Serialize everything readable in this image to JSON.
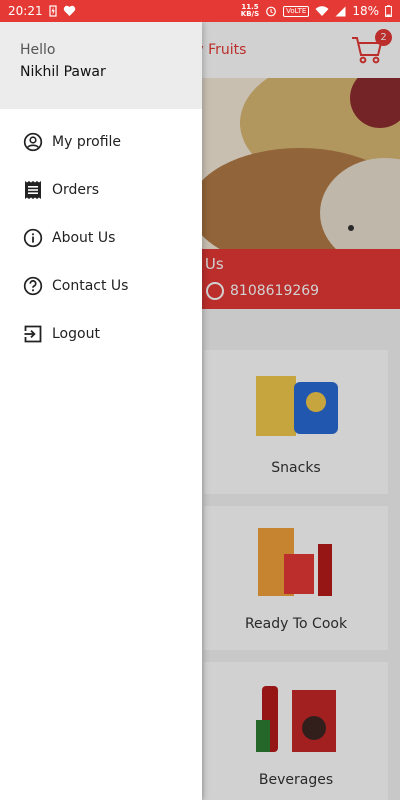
{
  "status_bar": {
    "time": "20:21",
    "netspeed_value": "11.5",
    "netspeed_unit": "KB/S",
    "volte": "VoLTE",
    "battery": "18%"
  },
  "app": {
    "title": "tu Dry Fruits",
    "cart_count": "2",
    "contact_title": "ct Us",
    "contact_phone": "8108619269",
    "categories": [
      {
        "label": "Snacks"
      },
      {
        "label": "Ready To Cook"
      },
      {
        "label": "Beverages"
      }
    ]
  },
  "drawer": {
    "greeting": "Hello",
    "user_name": "Nikhil Pawar",
    "items": [
      {
        "label": "My profile",
        "icon": "profile-icon"
      },
      {
        "label": "Orders",
        "icon": "orders-icon"
      },
      {
        "label": "About Us",
        "icon": "info-icon"
      },
      {
        "label": "Contact Us",
        "icon": "help-icon"
      },
      {
        "label": "Logout",
        "icon": "logout-icon"
      }
    ]
  },
  "colors": {
    "accent": "#e53935",
    "drawer_header": "#ececec"
  }
}
